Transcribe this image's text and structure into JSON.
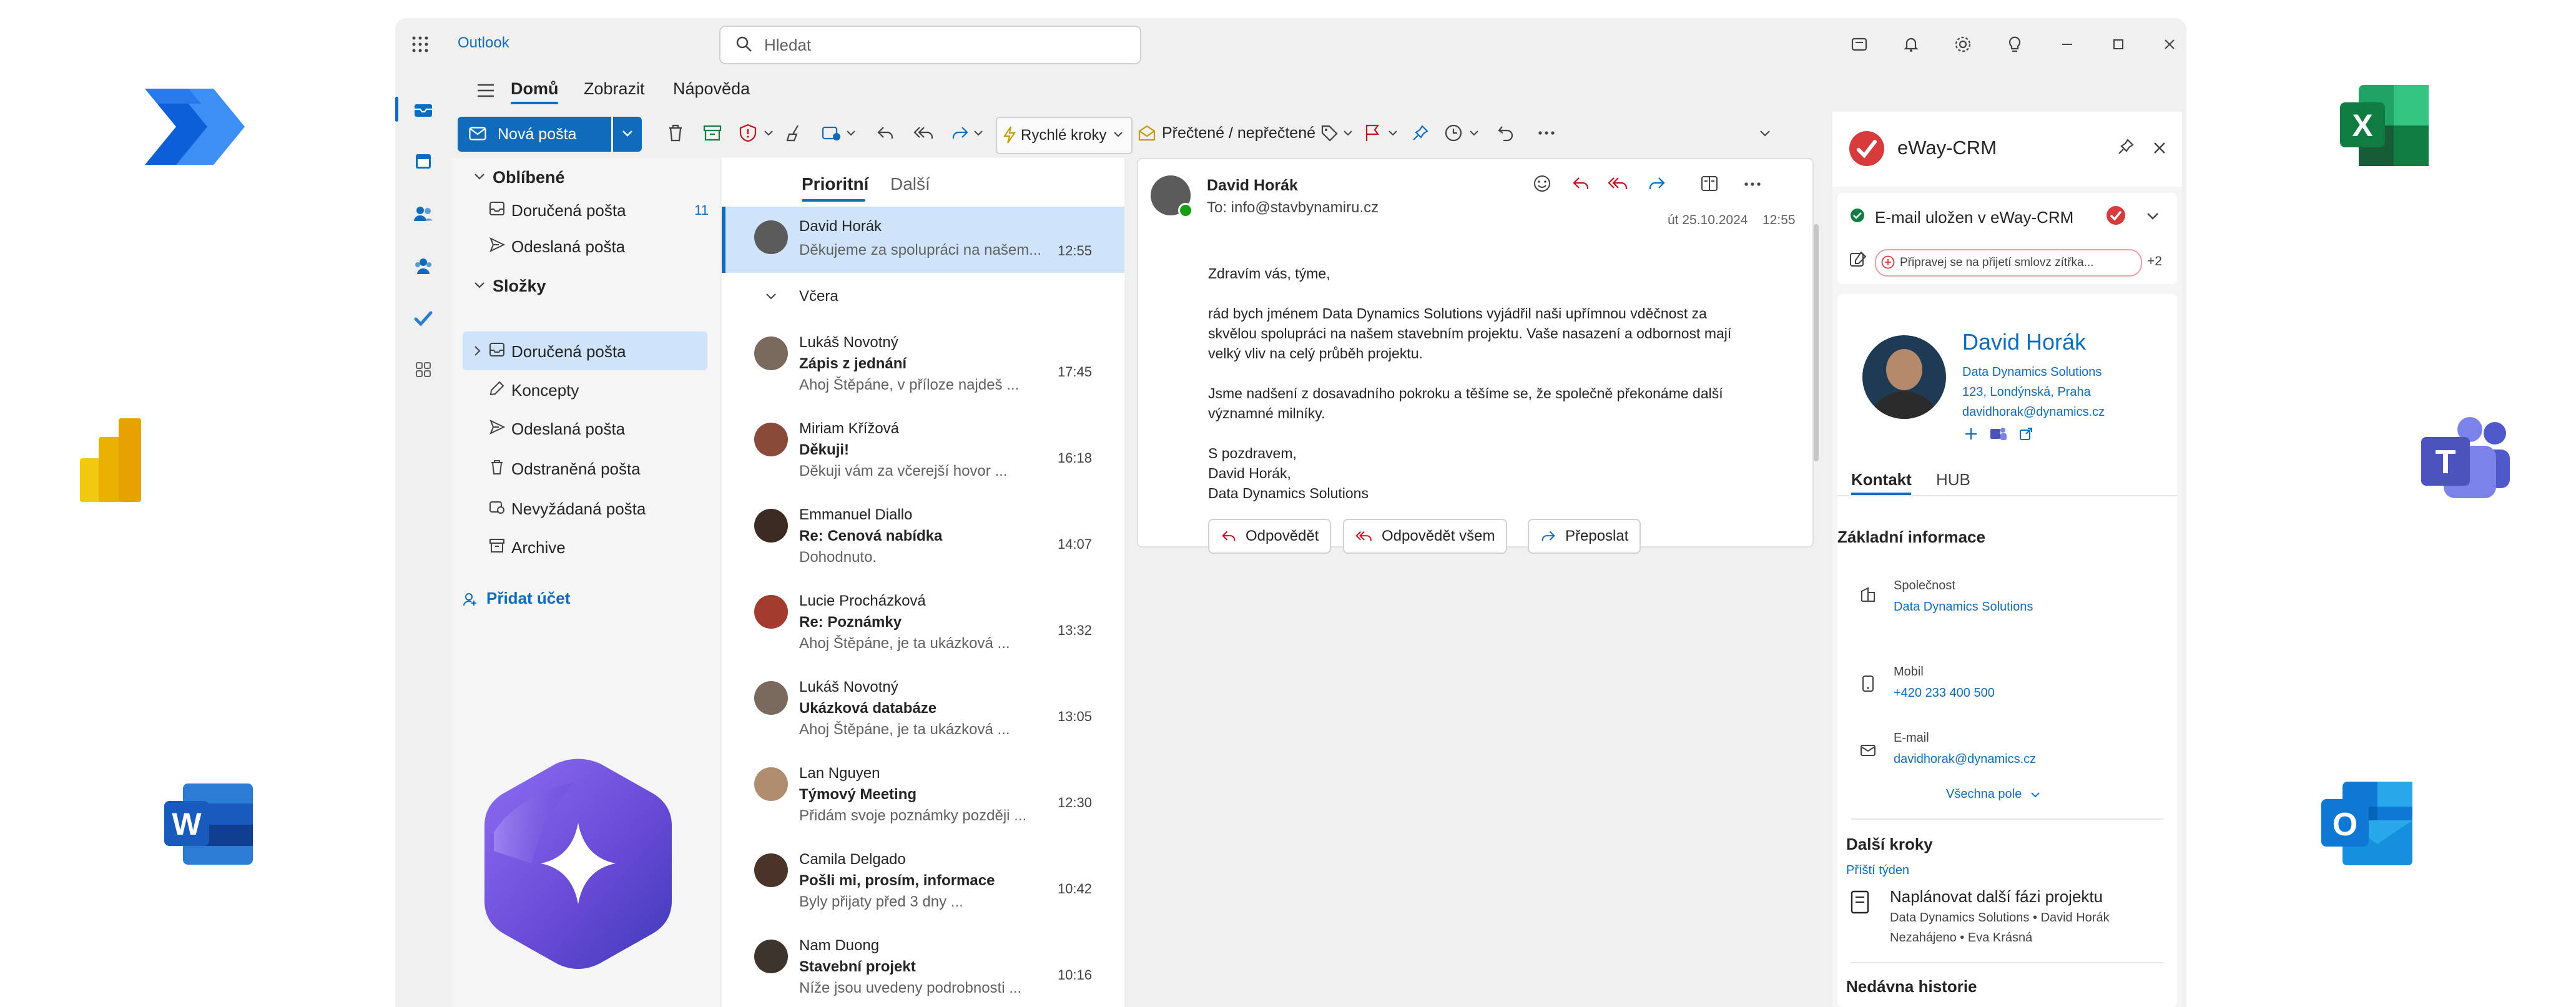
{
  "app": {
    "title": "Outlook"
  },
  "search": {
    "placeholder": "Hledat"
  },
  "ribbon_tabs": [
    "Domů",
    "Zobrazit",
    "Nápověda"
  ],
  "ribbon": {
    "new_mail": "Nová pošta",
    "quick_steps": "Rychlé kroky",
    "read_unread": "Přečtené / nepřečtené"
  },
  "folders": {
    "favorites_header": "Oblíbené",
    "favorites": [
      {
        "label": "Doručená pošta",
        "count": "11",
        "icon": "inbox-icon"
      },
      {
        "label": "Odeslaná pošta",
        "count": "",
        "icon": "send-icon"
      }
    ],
    "folders_header": "Složky",
    "items": [
      {
        "label": "Doručená pošta",
        "icon": "inbox-icon"
      },
      {
        "label": "Koncepty",
        "icon": "draft-icon"
      },
      {
        "label": "Odeslaná pošta",
        "icon": "send-icon"
      },
      {
        "label": "Odstraněná pošta",
        "icon": "trash-icon"
      },
      {
        "label": "Nevyžádaná pošta",
        "icon": "junk-icon"
      },
      {
        "label": "Archive",
        "icon": "archive-icon"
      }
    ],
    "add_account": "Přidat účet"
  },
  "mail_list": {
    "tabs": [
      "Prioritní",
      "Další"
    ],
    "group_yesterday": "Včera",
    "messages": [
      {
        "from": "David Horák",
        "subject": "",
        "preview": "Děkujeme za spolupráci na našem...",
        "time": "12:55"
      },
      {
        "from": "Lukáš Novotný",
        "subject": "Zápis z jednání",
        "preview": "Ahoj Štěpáne, v příloze najdeš ...",
        "time": "17:45"
      },
      {
        "from": "Miriam Křížová",
        "subject": "Děkuji!",
        "preview": "Děkuji vám za včerejší hovor ...",
        "time": "16:18"
      },
      {
        "from": "Emmanuel Diallo",
        "subject": "Re: Cenová nabídka",
        "preview": "Dohodnuto.",
        "time": "14:07"
      },
      {
        "from": "Lucie Procházková",
        "subject": "Re: Poznámky",
        "preview": "Ahoj Štěpáne, je ta ukázková ...",
        "time": "13:32"
      },
      {
        "from": "Lukáš Novotný",
        "subject": "Ukázková databáze",
        "preview": "Ahoj Štěpáne, je ta ukázková ...",
        "time": "13:05"
      },
      {
        "from": "Lan Nguyen",
        "subject": "Týmový Meeting",
        "preview": "Přidám svoje poznámky později ...",
        "time": "12:30"
      },
      {
        "from": "Camila Delgado",
        "subject": "Pošli mi, prosím, informace",
        "preview": "Byly přijaty před 3 dny ...",
        "time": "10:42"
      },
      {
        "from": "Nam Duong",
        "subject": "Stavební projekt",
        "preview": "Níže jsou uvedeny podrobnosti ...",
        "time": "10:16"
      }
    ]
  },
  "reading": {
    "from": "David Horák",
    "to": "To: info@stavbynamiru.cz",
    "date": "út 25.10.2024",
    "time": "12:55",
    "body": [
      "Zdravím vás, týme,",
      "rád bych jménem Data Dynamics Solutions vyjádřil naši upřímnou vděčnost za",
      "skvělou spolupráci na našem stavebním projektu. Vaše nasazení a odbornost mají",
      "velký vliv na celý průběh projektu.",
      "Jsme nadšení z dosavadního pokroku a těšíme se, že společně překonáme další",
      "významné milníky.",
      "S pozdravem,",
      "David Horák,",
      "Data Dynamics Solutions"
    ],
    "reply": "Odpovědět",
    "reply_all": "Odpovědět všem",
    "forward": "Přeposlat"
  },
  "eway": {
    "title": "eWay-CRM",
    "saved_status": "E-mail uložen v eWay-CRM",
    "reminder": "Připravej se na přijetí smlovz zítřka...",
    "reminder_more": "+2",
    "contact": {
      "name": "David Horák",
      "company": "Data Dynamics Solutions",
      "address": "123, Londýnská, Praha",
      "email": "davidhorak@dynamics.cz"
    },
    "tabs": [
      "Kontakt",
      "HUB"
    ],
    "basic_info_header": "Základní informace",
    "fields": [
      {
        "label": "Společnost",
        "value": "Data Dynamics Solutions",
        "icon": "building-icon"
      },
      {
        "label": "Mobil",
        "value": "+420 233 400 500",
        "icon": "phone-icon"
      },
      {
        "label": "E-mail",
        "value": "davidhorak@dynamics.cz",
        "icon": "mail-icon"
      }
    ],
    "all_fields": "Všechna pole",
    "next_steps_header": "Další kroky",
    "next_week": "Příští týden",
    "task": {
      "title": "Naplánovat další fázi projektu",
      "meta1": "Data Dynamics Solutions • David Horák",
      "meta2": "Nezahájeno • Eva Krásná"
    },
    "history_header": "Nedávna historie"
  },
  "colors": {
    "accent": "#0f6cbd",
    "selected": "#cfe4fa",
    "eway_red": "#d83b3b"
  },
  "logos": [
    "power-automate-icon",
    "power-bi-icon",
    "word-icon",
    "excel-icon",
    "teams-icon",
    "outlook-icon",
    "copilot-icon"
  ]
}
